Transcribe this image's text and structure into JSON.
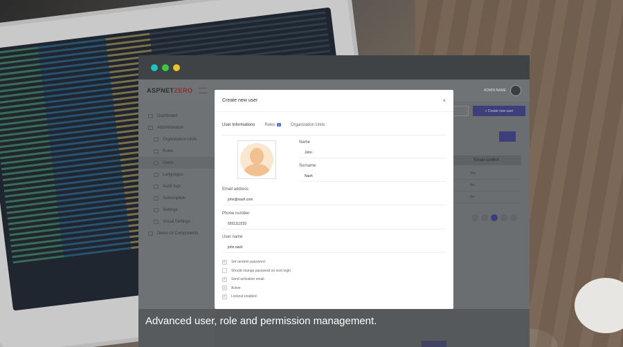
{
  "caption": "Advanced user, role and permission management.",
  "window": {
    "dots": [
      "#1bc6c0",
      "#3ec646",
      "#e8c32d"
    ]
  },
  "app": {
    "logo_main": "ASPNET",
    "logo_accent": "ZERO",
    "user_name": "ADMIN NAME",
    "new_user_button": "Create new user",
    "email_header": "Email confirm",
    "cells": [
      "Yes",
      "No",
      "No"
    ],
    "sidebar": [
      {
        "label": "Dashboard",
        "sub": false,
        "sel": false
      },
      {
        "label": "Administration",
        "sub": false,
        "sel": true
      },
      {
        "label": "Organization Units",
        "sub": true,
        "sel": false
      },
      {
        "label": "Roles",
        "sub": true,
        "sel": false
      },
      {
        "label": "Users",
        "sub": true,
        "sel": true
      },
      {
        "label": "Languages",
        "sub": true,
        "sel": false
      },
      {
        "label": "Audit logs",
        "sub": true,
        "sel": false
      },
      {
        "label": "Subscription",
        "sub": true,
        "sel": false
      },
      {
        "label": "Settings",
        "sub": true,
        "sel": false
      },
      {
        "label": "Visual Settings",
        "sub": true,
        "sel": false
      },
      {
        "label": "Demo UI Components",
        "sub": false,
        "sel": false
      }
    ]
  },
  "modal": {
    "title": "Create new user",
    "close": "×",
    "tabs": {
      "user_info": "User Informations",
      "roles": "Roles",
      "roles_count": "1",
      "org_units": "Organization Units"
    },
    "fields": {
      "name_label": "Name",
      "name_value": "John",
      "surname_label": "Surname",
      "surname_value": "Nash",
      "email_label": "Email address",
      "email_value": "john@nash.com",
      "phone_label": "Phone number",
      "phone_value": "5551112233",
      "username_label": "User name",
      "username_value": "john.nash"
    },
    "checkboxes": [
      {
        "label": "Set random password",
        "checked": true
      },
      {
        "label": "Should change password on next login",
        "checked": false
      },
      {
        "label": "Send activation email.",
        "checked": true
      },
      {
        "label": "Active",
        "checked": true
      },
      {
        "label": "Lockout enabled",
        "checked": true
      }
    ]
  }
}
